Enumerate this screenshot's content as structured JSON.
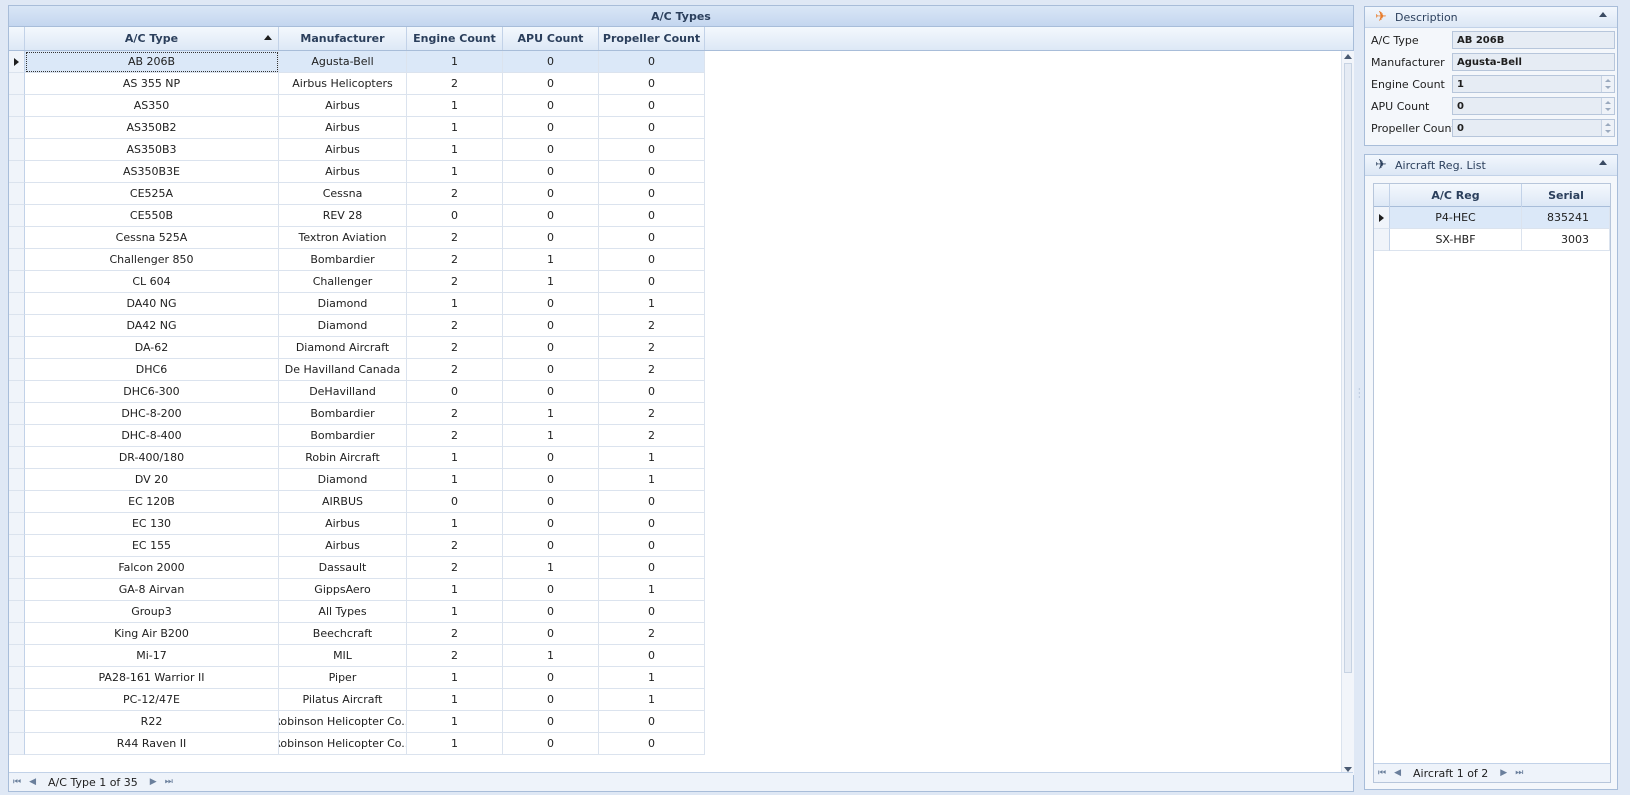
{
  "grid": {
    "caption": "A/C Types",
    "columns": [
      "A/C Type",
      "Manufacturer",
      "Engine Count",
      "APU Count",
      "Propeller Count"
    ],
    "rows": [
      [
        "AB 206B",
        "Agusta-Bell",
        "1",
        "0",
        "0"
      ],
      [
        "AS 355 NP",
        "Airbus Helicopters",
        "2",
        "0",
        "0"
      ],
      [
        "AS350",
        "Airbus",
        "1",
        "0",
        "0"
      ],
      [
        "AS350B2",
        "Airbus",
        "1",
        "0",
        "0"
      ],
      [
        "AS350B3",
        "Airbus",
        "1",
        "0",
        "0"
      ],
      [
        "AS350B3E",
        "Airbus",
        "1",
        "0",
        "0"
      ],
      [
        "CE525A",
        "Cessna",
        "2",
        "0",
        "0"
      ],
      [
        "CE550B",
        "REV 28",
        "0",
        "0",
        "0"
      ],
      [
        "Cessna 525A",
        "Textron Aviation",
        "2",
        "0",
        "0"
      ],
      [
        "Challenger 850",
        "Bombardier",
        "2",
        "1",
        "0"
      ],
      [
        "CL 604",
        "Challenger",
        "2",
        "1",
        "0"
      ],
      [
        "DA40 NG",
        "Diamond",
        "1",
        "0",
        "1"
      ],
      [
        "DA42 NG",
        "Diamond",
        "2",
        "0",
        "2"
      ],
      [
        "DA-62",
        "Diamond Aircraft",
        "2",
        "0",
        "2"
      ],
      [
        "DHC6",
        "De Havilland Canada",
        "2",
        "0",
        "2"
      ],
      [
        "DHC6-300",
        "DeHavilland",
        "0",
        "0",
        "0"
      ],
      [
        "DHC-8-200",
        "Bombardier",
        "2",
        "1",
        "2"
      ],
      [
        "DHC-8-400",
        "Bombardier",
        "2",
        "1",
        "2"
      ],
      [
        "DR-400/180",
        "Robin Aircraft",
        "1",
        "0",
        "1"
      ],
      [
        "DV 20",
        "Diamond",
        "1",
        "0",
        "1"
      ],
      [
        "EC 120B",
        "AIRBUS",
        "0",
        "0",
        "0"
      ],
      [
        "EC 130",
        "Airbus",
        "1",
        "0",
        "0"
      ],
      [
        "EC 155",
        "Airbus",
        "2",
        "0",
        "0"
      ],
      [
        "Falcon 2000",
        "Dassault",
        "2",
        "1",
        "0"
      ],
      [
        "GA-8 Airvan",
        "GippsAero",
        "1",
        "0",
        "1"
      ],
      [
        "Group3",
        "All Types",
        "1",
        "0",
        "0"
      ],
      [
        "King Air B200",
        "Beechcraft",
        "2",
        "0",
        "2"
      ],
      [
        "Mi-17",
        "MIL",
        "2",
        "1",
        "0"
      ],
      [
        "PA28-161 Warrior II",
        "Piper",
        "1",
        "0",
        "1"
      ],
      [
        "PC-12/47E",
        "Pilatus Aircraft",
        "1",
        "0",
        "1"
      ],
      [
        "R22",
        "Robinson Helicopter Co...",
        "1",
        "0",
        "0"
      ],
      [
        "R44 Raven II",
        "Robinson Helicopter Co...",
        "1",
        "0",
        "0"
      ]
    ],
    "selected_row": 0,
    "nav_text": "A/C Type 1 of 35"
  },
  "description": {
    "title": "Description",
    "fields": [
      {
        "label": "A/C Type",
        "value": "AB 206B",
        "spin": false
      },
      {
        "label": "Manufacturer",
        "value": "Agusta-Bell",
        "spin": false
      },
      {
        "label": "Engine Count",
        "value": "1",
        "spin": true
      },
      {
        "label": "APU Count",
        "value": "0",
        "spin": true
      },
      {
        "label": "Propeller Count",
        "value": "0",
        "spin": true
      }
    ]
  },
  "reg_list": {
    "title": "Aircraft Reg. List",
    "columns": [
      "A/C Reg",
      "Serial"
    ],
    "rows": [
      [
        "P4-HEC",
        "835241"
      ],
      [
        "SX-HBF",
        "3003"
      ]
    ],
    "nav_text": "Aircraft 1 of 2"
  },
  "icons": {
    "description": "airplane-icon",
    "reg_list": "aircraft-icon"
  },
  "colors": {
    "accent": "#e87b2a",
    "header_bg": "#dde8f6",
    "selection": "#dbe8f8"
  }
}
